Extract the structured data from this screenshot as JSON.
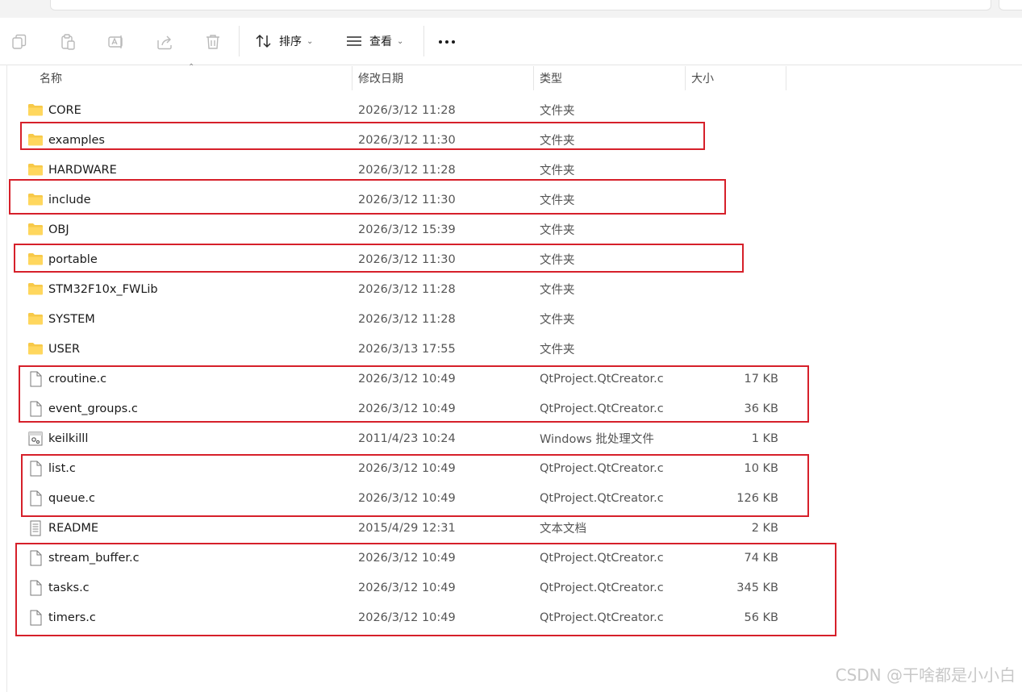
{
  "toolbar": {
    "sort_label": "排序",
    "view_label": "查看"
  },
  "columns": {
    "name": "名称",
    "date": "修改日期",
    "type": "类型",
    "size": "大小"
  },
  "files": [
    {
      "name": "CORE",
      "date": "2026/3/12 11:28",
      "type": "文件夹",
      "size": "",
      "icon": "folder-icon"
    },
    {
      "name": "examples",
      "date": "2026/3/12 11:30",
      "type": "文件夹",
      "size": "",
      "icon": "folder-icon"
    },
    {
      "name": "HARDWARE",
      "date": "2026/3/12 11:28",
      "type": "文件夹",
      "size": "",
      "icon": "folder-icon"
    },
    {
      "name": "include",
      "date": "2026/3/12 11:30",
      "type": "文件夹",
      "size": "",
      "icon": "folder-icon"
    },
    {
      "name": "OBJ",
      "date": "2026/3/12 15:39",
      "type": "文件夹",
      "size": "",
      "icon": "folder-icon"
    },
    {
      "name": "portable",
      "date": "2026/3/12 11:30",
      "type": "文件夹",
      "size": "",
      "icon": "folder-icon"
    },
    {
      "name": "STM32F10x_FWLib",
      "date": "2026/3/12 11:28",
      "type": "文件夹",
      "size": "",
      "icon": "folder-icon"
    },
    {
      "name": "SYSTEM",
      "date": "2026/3/12 11:28",
      "type": "文件夹",
      "size": "",
      "icon": "folder-icon"
    },
    {
      "name": "USER",
      "date": "2026/3/13 17:55",
      "type": "文件夹",
      "size": "",
      "icon": "folder-icon"
    },
    {
      "name": "croutine.c",
      "date": "2026/3/12 10:49",
      "type": "QtProject.QtCreator.c",
      "size": "17 KB",
      "icon": "file-icon"
    },
    {
      "name": "event_groups.c",
      "date": "2026/3/12 10:49",
      "type": "QtProject.QtCreator.c",
      "size": "36 KB",
      "icon": "file-icon"
    },
    {
      "name": "keilkilll",
      "date": "2011/4/23 10:24",
      "type": "Windows 批处理文件",
      "size": "1 KB",
      "icon": "batch-file-icon"
    },
    {
      "name": "list.c",
      "date": "2026/3/12 10:49",
      "type": "QtProject.QtCreator.c",
      "size": "10 KB",
      "icon": "file-icon"
    },
    {
      "name": "queue.c",
      "date": "2026/3/12 10:49",
      "type": "QtProject.QtCreator.c",
      "size": "126 KB",
      "icon": "file-icon"
    },
    {
      "name": "README",
      "date": "2015/4/29 12:31",
      "type": "文本文档",
      "size": "2 KB",
      "icon": "text-file-icon"
    },
    {
      "name": "stream_buffer.c",
      "date": "2026/3/12 10:49",
      "type": "QtProject.QtCreator.c",
      "size": "74 KB",
      "icon": "file-icon"
    },
    {
      "name": "tasks.c",
      "date": "2026/3/12 10:49",
      "type": "QtProject.QtCreator.c",
      "size": "345 KB",
      "icon": "file-icon"
    },
    {
      "name": "timers.c",
      "date": "2026/3/12 10:49",
      "type": "QtProject.QtCreator.c",
      "size": "56 KB",
      "icon": "file-icon"
    }
  ],
  "watermark": "CSDN @干啥都是小小白",
  "colors": {
    "highlight": "#d6202a",
    "folder": "#f7c948"
  }
}
